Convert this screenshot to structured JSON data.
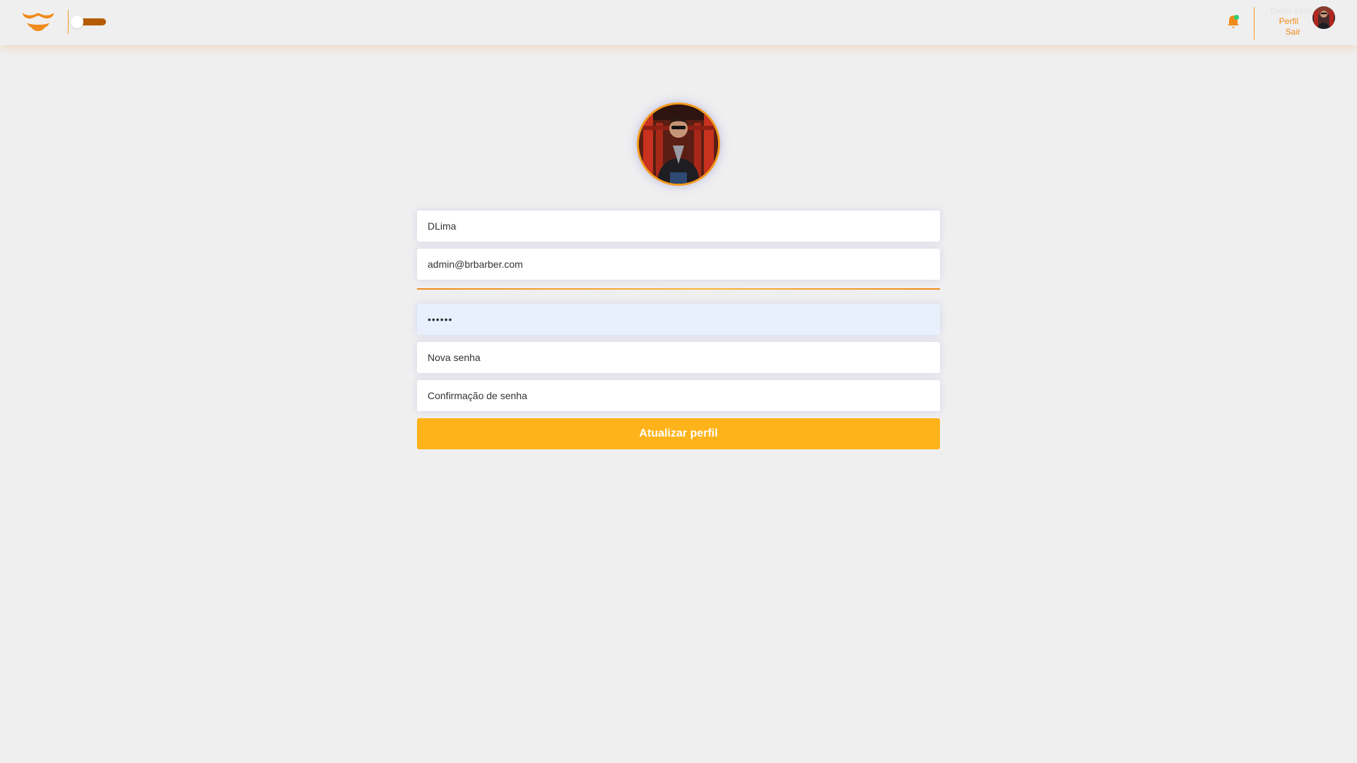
{
  "header": {
    "logo_icon": "mustache-smile-logo",
    "theme_toggle_state": "off",
    "notification_icon": "bell-icon",
    "notification_indicator_color": "#2ecc71",
    "user_name": "Diego Lima",
    "menu": {
      "profile_label": "Perfil",
      "logout_label": "Sair"
    }
  },
  "profile_form": {
    "name_value": "DLima",
    "email_value": "admin@brbarber.com",
    "old_password_value": "••••••",
    "new_password_placeholder": "Nova senha",
    "confirm_password_placeholder": "Confirmação de senha",
    "submit_label": "Atualizar perfil"
  },
  "colors": {
    "accent": "#f39b1e",
    "button": "#ffb31a",
    "toggle_track": "#b35c04",
    "background": "#efeff0"
  }
}
